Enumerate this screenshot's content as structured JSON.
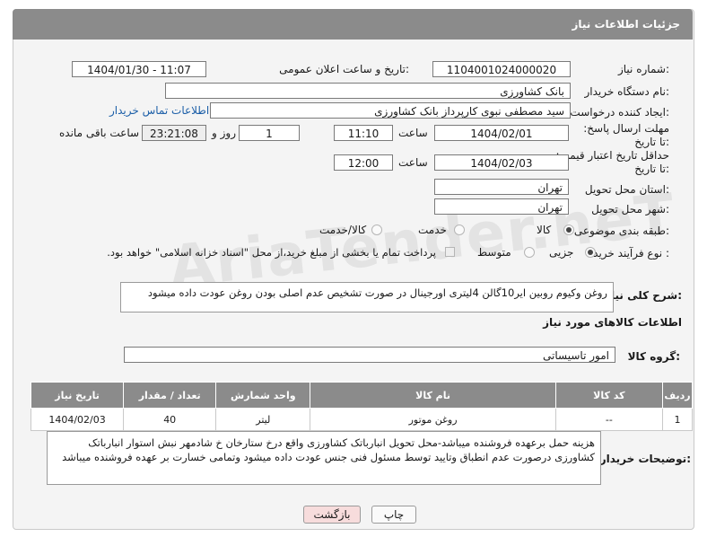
{
  "header": {
    "title": "جزئیات اطلاعات نیاز"
  },
  "fields": {
    "need_number_label": "شماره نیاز:",
    "need_number": "1104001024000020",
    "announce_label": "تاریخ و ساعت اعلان عمومی:",
    "announce_value": "1404/01/30 - 11:07",
    "buyer_org_label": "نام دستگاه خریدار:",
    "buyer_org": "بانک کشاورزی",
    "creator_label": "ایجاد کننده درخواست:",
    "creator": "سید مصطفی نبوی کارپرداز بانک کشاورزی",
    "contact_link": "اطلاعات تماس خریدار",
    "deadline_label": "مهلت ارسال پاسخ: تا تاریخ:",
    "deadline_date": "1404/02/01",
    "time_label": "ساعت",
    "deadline_time": "11:10",
    "days_value": "1",
    "days_label": "روز و",
    "remaining_value": "23:21:08",
    "remaining_label": "ساعت باقی مانده",
    "validity_label": "حداقل تاریخ اعتبار قیمت: تا تاریخ:",
    "validity_date": "1404/02/03",
    "validity_time": "12:00",
    "province_label": "استان محل تحویل:",
    "province": "تهران",
    "city_label": "شهر محل تحویل:",
    "city": "تهران",
    "category_label": "طبقه بندی موضوعی:",
    "category_options": [
      "کالا",
      "خدمت",
      "کالا/خدمت"
    ],
    "category_selected": "کالا",
    "process_label": "نوع فرآیند خرید :",
    "process_options": [
      "جزیی",
      "متوسط"
    ],
    "process_selected": "جزیی",
    "payment_note": "پرداخت تمام یا بخشی از مبلغ خرید،از محل \"اسناد خزانه اسلامی\" خواهد بود.",
    "description_label": "شرح کلی نیاز:",
    "description": "روغن وکیوم روبین ایر10گالن 4لیتری اورجینال در صورت تشخیص عدم اصلی بودن روغن عودت داده میشود"
  },
  "goods": {
    "section_title": "اطلاعات کالاهای مورد نیاز",
    "group_label": "گروه کالا:",
    "group_value": "امور تاسیساتی",
    "columns": [
      "ردیف",
      "کد کالا",
      "نام کالا",
      "واحد شمارش",
      "تعداد / مقدار",
      "تاریخ نیاز"
    ],
    "rows": [
      {
        "index": "1",
        "code": "--",
        "name": "روغن موتور",
        "unit": "لیتر",
        "qty": "40",
        "date": "1404/02/03"
      }
    ]
  },
  "buyer_notes": {
    "label": "توضیحات خریدار:",
    "text": "هزینه حمل برعهده فروشنده میباشد-محل تحویل انبارباتک کشاورزی واقع درخ ستارخان خ شادمهر نبش استوار انبارباتک کشاورزی درصورت عدم انطباق وتایید توسط مسئول فنی جنس عودت داده میشود وتمامی خسارت بر عهده فروشنده میباشد"
  },
  "buttons": {
    "print": "چاپ",
    "back": "بازگشت"
  },
  "watermark": "AriaTender.neT",
  "colors": {
    "header": "#8b8b8b",
    "link": "#1c5fa8",
    "back_button": "#f7dcdc"
  }
}
